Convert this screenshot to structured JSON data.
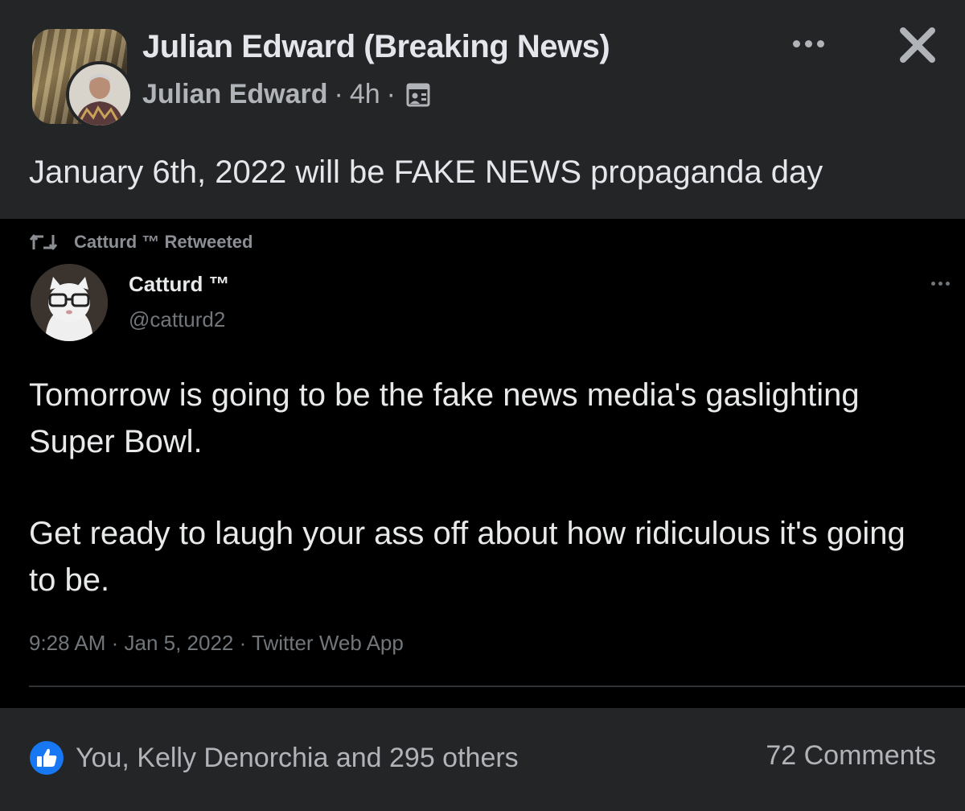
{
  "post": {
    "title": "Julian Edward (Breaking News)",
    "author": "Julian Edward",
    "time": "4h",
    "meta_separator": "·",
    "text": "January 6th, 2022 will be FAKE NEWS propaganda day",
    "audience_icon": "audience-icon"
  },
  "tweet": {
    "retweet_label": "Catturd ™ Retweeted",
    "name": "Catturd ™",
    "handle": "@catturd2",
    "body": [
      "Tomorrow is going to be the fake news media's gaslighting Super Bowl.",
      "Get ready to laugh your ass off about how ridiculous it's going to be."
    ],
    "footer": "9:28 AM · Jan 5, 2022 · Twitter Web App"
  },
  "reactions": {
    "likes_text": "You, Kelly Denorchia and 295 others",
    "comments_text": "72 Comments"
  },
  "colors": {
    "background": "#242526",
    "tweet_background": "#000000",
    "like_blue": "#1877f2",
    "primary_text": "#e4e6eb",
    "secondary_text": "#b0b3b8"
  }
}
